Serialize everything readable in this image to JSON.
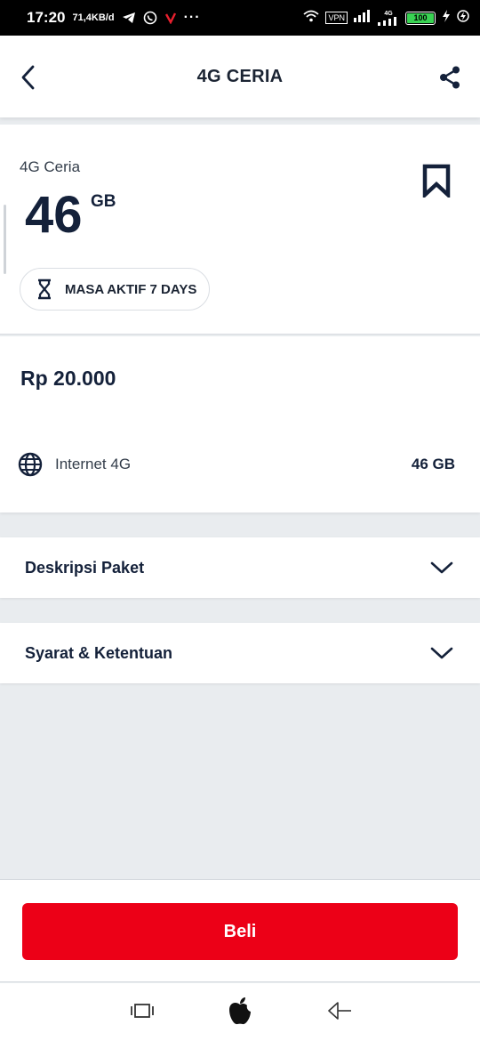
{
  "status_bar": {
    "time": "17:20",
    "speed": "71,4KB/d",
    "dots": "···",
    "vpn": "VPN",
    "network": "4G",
    "battery": "100"
  },
  "header": {
    "title": "4G CERIA"
  },
  "package": {
    "name": "4G Ceria",
    "quota_value": "46",
    "quota_unit": "GB",
    "active_period": "MASA AKTIF 7 DAYS"
  },
  "pricing": {
    "price": "Rp 20.000",
    "benefits": [
      {
        "label": "Internet 4G",
        "value": "46 GB"
      }
    ]
  },
  "sections": [
    {
      "title": "Deskripsi Paket"
    },
    {
      "title": "Syarat & Ketentuan"
    }
  ],
  "actions": {
    "buy_label": "Beli"
  },
  "colors": {
    "primary": "#ec0017",
    "text_dark": "#14213a",
    "background": "#e9ecef"
  }
}
